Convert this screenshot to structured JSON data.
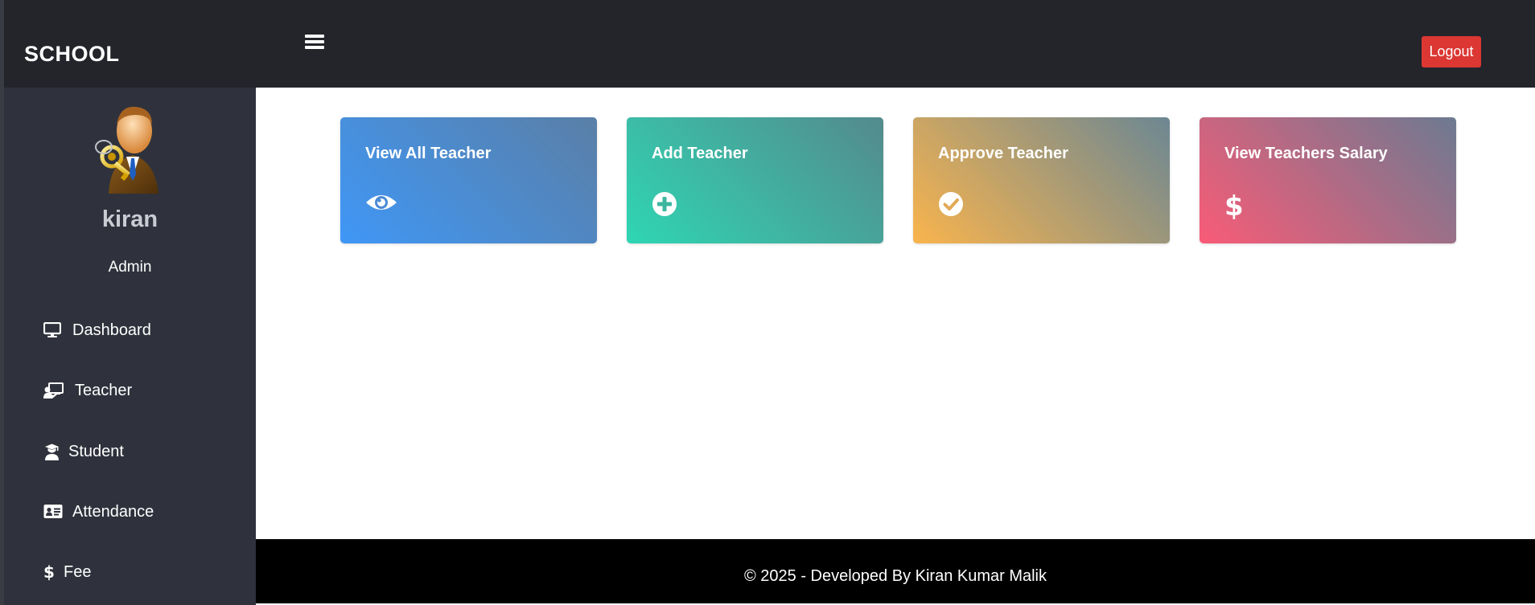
{
  "brand": "SCHOOL",
  "header": {
    "logout_label": "Logout",
    "logout_color": "#dc3733"
  },
  "user": {
    "name": "kiran",
    "role": "Admin"
  },
  "sidebar": {
    "items": [
      {
        "label": "Dashboard",
        "icon": "monitor-icon"
      },
      {
        "label": "Teacher",
        "icon": "chalkboard-teacher-icon"
      },
      {
        "label": "Student",
        "icon": "graduate-icon"
      },
      {
        "label": "Attendance",
        "icon": "id-card-icon"
      },
      {
        "label": "Fee",
        "icon": "dollar-icon"
      }
    ]
  },
  "cards": [
    {
      "title": "View All Teacher",
      "icon": "eye-icon"
    },
    {
      "title": "Add Teacher",
      "icon": "plus-circle-icon"
    },
    {
      "title": "Approve Teacher",
      "icon": "check-circle-icon"
    },
    {
      "title": "View Teachers Salary",
      "icon": "dollar-icon"
    }
  ],
  "footer": {
    "text": "© 2025 - Developed By Kiran Kumar Malik"
  }
}
